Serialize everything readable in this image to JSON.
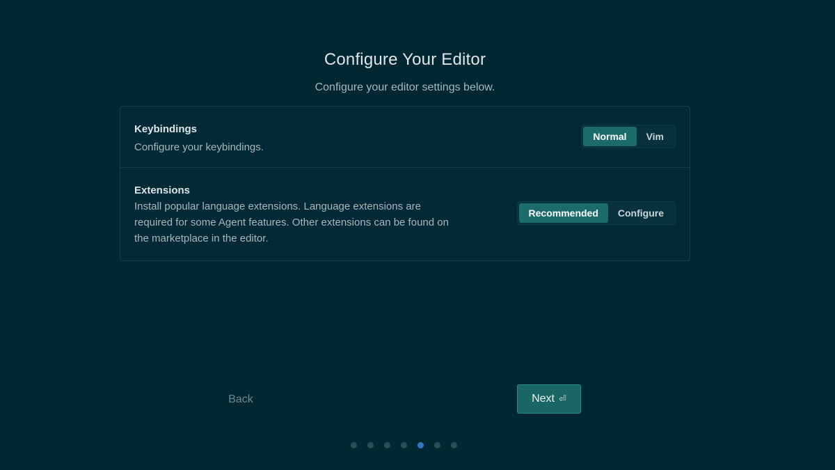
{
  "header": {
    "title": "Configure Your Editor",
    "subtitle": "Configure your editor settings below."
  },
  "settings": {
    "keybindings": {
      "title": "Keybindings",
      "description": "Configure your keybindings.",
      "options": [
        "Normal",
        "Vim"
      ],
      "selected": "Normal"
    },
    "extensions": {
      "title": "Extensions",
      "description": "Install popular language extensions. Language extensions are required for some Agent features. Other extensions can be found on the marketplace in the editor.",
      "options": [
        "Recommended",
        "Configure"
      ],
      "selected": "Recommended"
    }
  },
  "navigation": {
    "back_label": "Back",
    "next_label": "Next",
    "next_icon": "enter-key-icon"
  },
  "progress": {
    "total_steps": 7,
    "current_step": 5
  },
  "colors": {
    "background": "#012733",
    "accent": "#1c6b6b",
    "active_dot": "#2f78c2"
  }
}
